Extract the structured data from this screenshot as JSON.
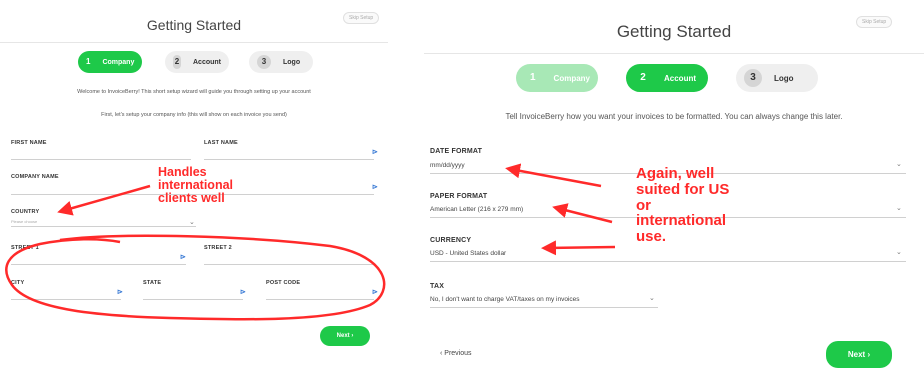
{
  "left": {
    "title": "Getting Started",
    "skip_label": "Skip Setup",
    "steps": [
      {
        "num": "1",
        "label": "Company"
      },
      {
        "num": "2",
        "label": "Account"
      },
      {
        "num": "3",
        "label": "Logo"
      }
    ],
    "welcome_text": "Welcome to InvoiceBerry! This short setup wizard will guide you through setting up your account",
    "company_info_text": "First, let's setup your company info (this will show on each invoice you send)",
    "fields": {
      "first_name": "FIRST NAME",
      "last_name": "LAST NAME",
      "company_name": "COMPANY NAME",
      "country": "COUNTRY",
      "country_placeholder": "Please choose",
      "street1": "STREET 1",
      "street2": "STREET 2",
      "city": "CITY",
      "state": "STATE",
      "post_code": "POST CODE"
    },
    "next_label": "Next ›",
    "annotation": [
      "Handles",
      "international",
      "clients well"
    ]
  },
  "right": {
    "title": "Getting Started",
    "skip_label": "Skip Setup",
    "steps": [
      {
        "num": "1",
        "label": "Company"
      },
      {
        "num": "2",
        "label": "Account"
      },
      {
        "num": "3",
        "label": "Logo"
      }
    ],
    "intro_text": "Tell InvoiceBerry how you want your invoices to be formatted. You can always change this later.",
    "date_format": {
      "label": "DATE FORMAT",
      "value": "mm/dd/yyyy"
    },
    "paper_format": {
      "label": "PAPER FORMAT",
      "value": "American Letter (216 x 279 mm)"
    },
    "currency": {
      "label": "CURRENCY",
      "value": "USD - United States dollar"
    },
    "tax": {
      "label": "TAX",
      "value": "No, I don't want to charge VAT/taxes on my invoices"
    },
    "previous_label": "‹ Previous",
    "next_label": "Next ›",
    "annotation": [
      "Again, well",
      "suited for US",
      "or",
      "international",
      "use."
    ]
  },
  "colors": {
    "accent": "#1ec949",
    "accent_light": "#a8e8b6",
    "annotation": "#ff2a2a"
  }
}
